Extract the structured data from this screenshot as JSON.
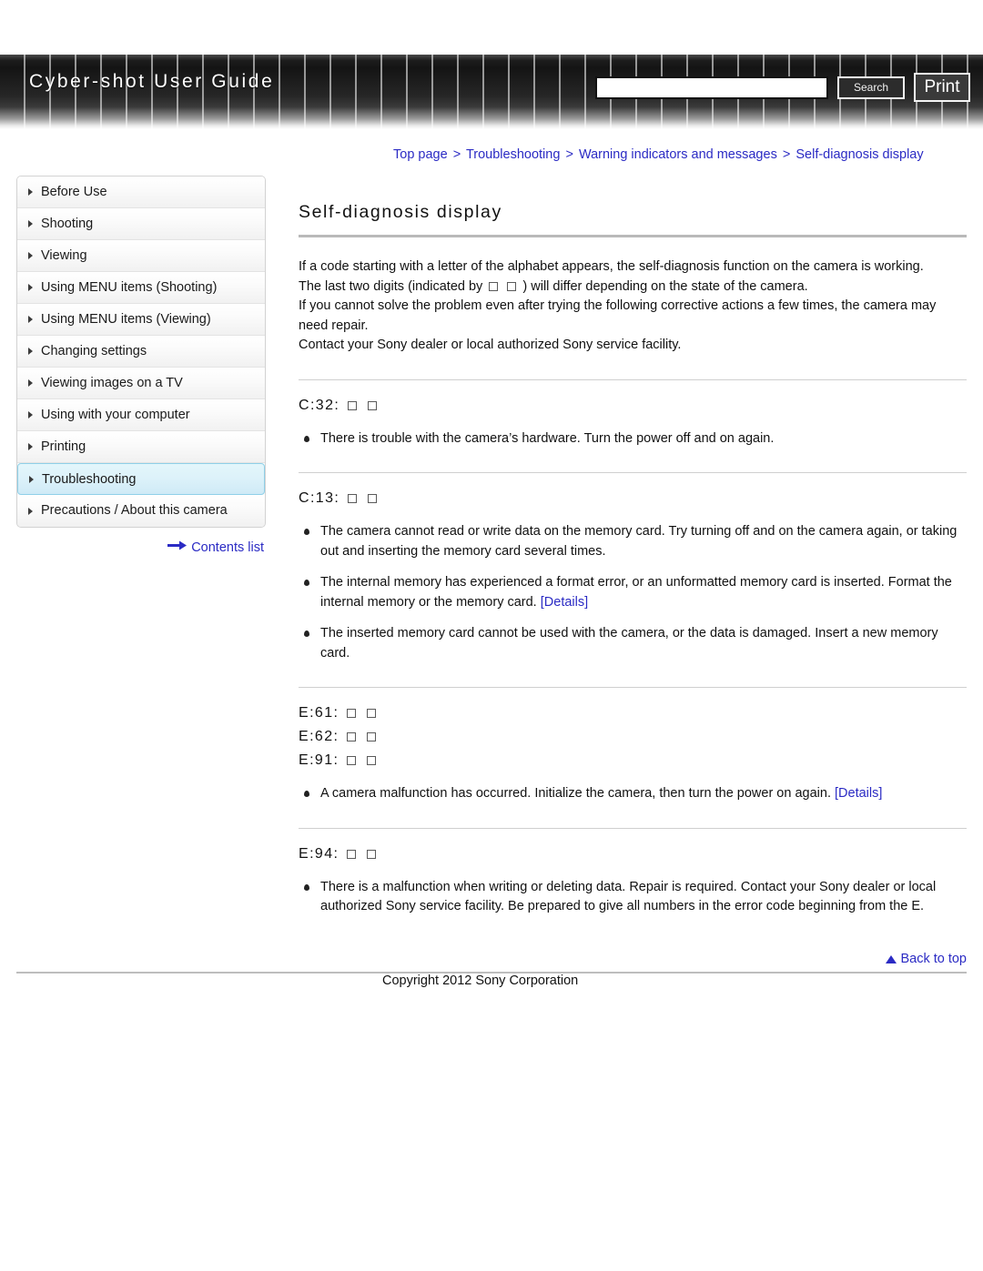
{
  "header": {
    "brand_title": "Cyber-shot User Guide",
    "search": {
      "value": "",
      "placeholder": "",
      "button_label": "Search"
    },
    "print_label": "Print"
  },
  "breadcrumb": {
    "items": [
      {
        "label": "Top page"
      },
      {
        "label": "Troubleshooting"
      },
      {
        "label": "Warning indicators and messages"
      },
      {
        "label": "Self-diagnosis display"
      }
    ],
    "separator": ">"
  },
  "sidebar": {
    "items": [
      {
        "label": "Before Use",
        "selected": false
      },
      {
        "label": "Shooting",
        "selected": false
      },
      {
        "label": "Viewing",
        "selected": false
      },
      {
        "label": "Using MENU items (Shooting)",
        "selected": false
      },
      {
        "label": "Using MENU items (Viewing)",
        "selected": false
      },
      {
        "label": "Changing settings",
        "selected": false
      },
      {
        "label": "Viewing images on a TV",
        "selected": false
      },
      {
        "label": "Using with your computer",
        "selected": false
      },
      {
        "label": "Printing",
        "selected": false
      },
      {
        "label": "Troubleshooting",
        "selected": true
      },
      {
        "label": "Precautions / About this camera",
        "selected": false
      }
    ],
    "contents_link": "Contents list"
  },
  "main": {
    "title": "Self-diagnosis display",
    "intro": {
      "line1": "If a code starting with a letter of the alphabet appears, the self-diagnosis function on the camera is working.",
      "line2_pre": "The last two digits (indicated by",
      "line2_post": ") will differ depending on the state of the camera.",
      "line3": "If you cannot solve the problem even after trying the following corrective actions a few times, the camera may need repair.",
      "line4": "Contact your Sony dealer or local authorized Sony service facility."
    },
    "sections": [
      {
        "codes": [
          "C:32:"
        ],
        "bullets": [
          {
            "text": "There is trouble with the camera’s hardware. Turn the power off and on again.",
            "link": ""
          }
        ]
      },
      {
        "codes": [
          "C:13:"
        ],
        "bullets": [
          {
            "text": "The camera cannot read or write data on the memory card. Try turning off and on the camera again, or taking out and inserting the memory card several times.",
            "link": ""
          },
          {
            "text": "The internal memory has experienced a format error, or an unformatted memory card is inserted. Format the internal memory or the memory card.",
            "link": "[Details]"
          },
          {
            "text": "The inserted memory card cannot be used with the camera, or the data is damaged. Insert a new memory card.",
            "link": ""
          }
        ]
      },
      {
        "codes": [
          "E:61:",
          "E:62:",
          "E:91:"
        ],
        "bullets": [
          {
            "text": "A camera malfunction has occurred. Initialize the camera, then turn the power on again.",
            "link": "[Details]"
          }
        ]
      },
      {
        "codes": [
          "E:94:"
        ],
        "bullets": [
          {
            "text": "There is a malfunction when writing or deleting data. Repair is required. Contact your Sony dealer or local authorized Sony service facility. Be prepared to give all numbers in the error code beginning from the E.",
            "link": ""
          }
        ]
      }
    ]
  },
  "footer": {
    "back_to_top": "Back to top",
    "copyright": "Copyright 2012 Sony Corporation"
  },
  "colors": {
    "link": "#2b2bc4",
    "selected_nav_bg": "#ddf2fa",
    "selected_nav_border": "#8fd0e8",
    "header_dark": "#141414"
  }
}
